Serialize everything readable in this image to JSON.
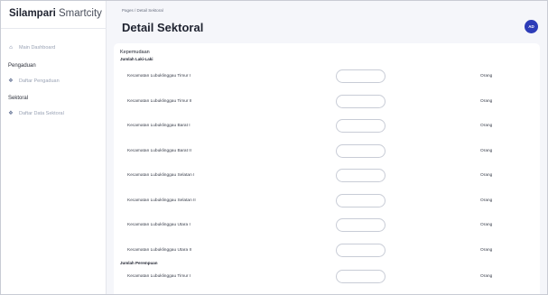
{
  "app": {
    "brand_bold": "Silampari",
    "brand_light": "Smartcity"
  },
  "sidebar": {
    "main_item": "Main Dashboard",
    "group1_title": "Pengaduan",
    "group1_item": "Daftar Pengaduan",
    "group2_title": "Sektoral",
    "group2_item": "Daftar Data Sektoral"
  },
  "header": {
    "breadcrumb": "Pages / Detail Sektoral",
    "title": "Detail Sektoral",
    "avatar": "AD"
  },
  "form": {
    "section_title": "Kepemudaan",
    "group_male": "Jumlah Laki-Laki",
    "group_female": "Jumlah Perempuan",
    "unit": "Orang",
    "male_rows": [
      "Kecamatan Lubuklinggau Timur I",
      "Kecamatan Lubuklinggau Timur II",
      "Kecamatan Lubuklinggau Barat I",
      "Kecamatan Lubuklinggau Barat II",
      "Kecamatan Lubuklinggau Selatan I",
      "Kecamatan Lubuklinggau Selatan II",
      "Kecamatan Lubuklinggau Utara I",
      "Kecamatan Lubuklinggau Utara II"
    ],
    "female_rows": [
      "Kecamatan Lubuklinggau Timur I"
    ]
  }
}
